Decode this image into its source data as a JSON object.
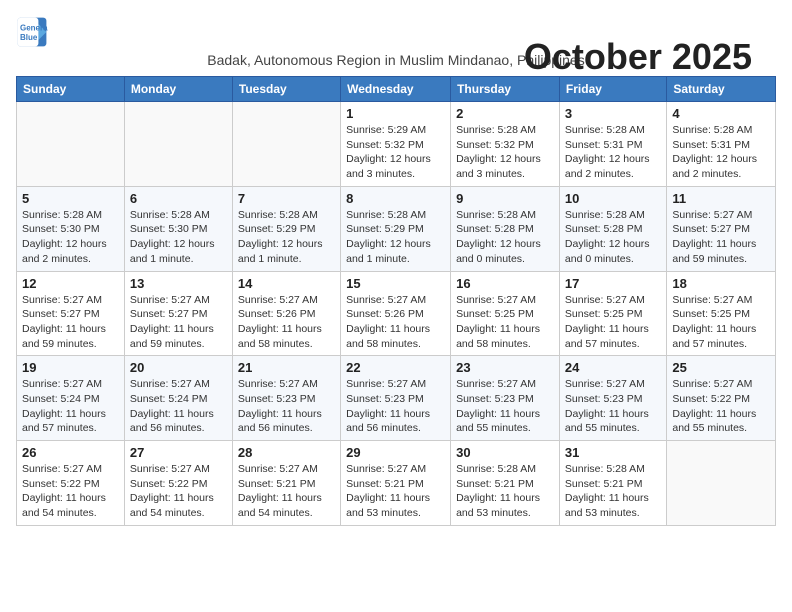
{
  "logo": {
    "line1": "General",
    "line2": "Blue"
  },
  "title": "October 2025",
  "subtitle": "Badak, Autonomous Region in Muslim Mindanao, Philippines",
  "headers": [
    "Sunday",
    "Monday",
    "Tuesday",
    "Wednesday",
    "Thursday",
    "Friday",
    "Saturday"
  ],
  "weeks": [
    [
      {
        "day": "",
        "info": ""
      },
      {
        "day": "",
        "info": ""
      },
      {
        "day": "",
        "info": ""
      },
      {
        "day": "1",
        "info": "Sunrise: 5:29 AM\nSunset: 5:32 PM\nDaylight: 12 hours\nand 3 minutes."
      },
      {
        "day": "2",
        "info": "Sunrise: 5:28 AM\nSunset: 5:32 PM\nDaylight: 12 hours\nand 3 minutes."
      },
      {
        "day": "3",
        "info": "Sunrise: 5:28 AM\nSunset: 5:31 PM\nDaylight: 12 hours\nand 2 minutes."
      },
      {
        "day": "4",
        "info": "Sunrise: 5:28 AM\nSunset: 5:31 PM\nDaylight: 12 hours\nand 2 minutes."
      }
    ],
    [
      {
        "day": "5",
        "info": "Sunrise: 5:28 AM\nSunset: 5:30 PM\nDaylight: 12 hours\nand 2 minutes."
      },
      {
        "day": "6",
        "info": "Sunrise: 5:28 AM\nSunset: 5:30 PM\nDaylight: 12 hours\nand 1 minute."
      },
      {
        "day": "7",
        "info": "Sunrise: 5:28 AM\nSunset: 5:29 PM\nDaylight: 12 hours\nand 1 minute."
      },
      {
        "day": "8",
        "info": "Sunrise: 5:28 AM\nSunset: 5:29 PM\nDaylight: 12 hours\nand 1 minute."
      },
      {
        "day": "9",
        "info": "Sunrise: 5:28 AM\nSunset: 5:28 PM\nDaylight: 12 hours\nand 0 minutes."
      },
      {
        "day": "10",
        "info": "Sunrise: 5:28 AM\nSunset: 5:28 PM\nDaylight: 12 hours\nand 0 minutes."
      },
      {
        "day": "11",
        "info": "Sunrise: 5:27 AM\nSunset: 5:27 PM\nDaylight: 11 hours\nand 59 minutes."
      }
    ],
    [
      {
        "day": "12",
        "info": "Sunrise: 5:27 AM\nSunset: 5:27 PM\nDaylight: 11 hours\nand 59 minutes."
      },
      {
        "day": "13",
        "info": "Sunrise: 5:27 AM\nSunset: 5:27 PM\nDaylight: 11 hours\nand 59 minutes."
      },
      {
        "day": "14",
        "info": "Sunrise: 5:27 AM\nSunset: 5:26 PM\nDaylight: 11 hours\nand 58 minutes."
      },
      {
        "day": "15",
        "info": "Sunrise: 5:27 AM\nSunset: 5:26 PM\nDaylight: 11 hours\nand 58 minutes."
      },
      {
        "day": "16",
        "info": "Sunrise: 5:27 AM\nSunset: 5:25 PM\nDaylight: 11 hours\nand 58 minutes."
      },
      {
        "day": "17",
        "info": "Sunrise: 5:27 AM\nSunset: 5:25 PM\nDaylight: 11 hours\nand 57 minutes."
      },
      {
        "day": "18",
        "info": "Sunrise: 5:27 AM\nSunset: 5:25 PM\nDaylight: 11 hours\nand 57 minutes."
      }
    ],
    [
      {
        "day": "19",
        "info": "Sunrise: 5:27 AM\nSunset: 5:24 PM\nDaylight: 11 hours\nand 57 minutes."
      },
      {
        "day": "20",
        "info": "Sunrise: 5:27 AM\nSunset: 5:24 PM\nDaylight: 11 hours\nand 56 minutes."
      },
      {
        "day": "21",
        "info": "Sunrise: 5:27 AM\nSunset: 5:23 PM\nDaylight: 11 hours\nand 56 minutes."
      },
      {
        "day": "22",
        "info": "Sunrise: 5:27 AM\nSunset: 5:23 PM\nDaylight: 11 hours\nand 56 minutes."
      },
      {
        "day": "23",
        "info": "Sunrise: 5:27 AM\nSunset: 5:23 PM\nDaylight: 11 hours\nand 55 minutes."
      },
      {
        "day": "24",
        "info": "Sunrise: 5:27 AM\nSunset: 5:23 PM\nDaylight: 11 hours\nand 55 minutes."
      },
      {
        "day": "25",
        "info": "Sunrise: 5:27 AM\nSunset: 5:22 PM\nDaylight: 11 hours\nand 55 minutes."
      }
    ],
    [
      {
        "day": "26",
        "info": "Sunrise: 5:27 AM\nSunset: 5:22 PM\nDaylight: 11 hours\nand 54 minutes."
      },
      {
        "day": "27",
        "info": "Sunrise: 5:27 AM\nSunset: 5:22 PM\nDaylight: 11 hours\nand 54 minutes."
      },
      {
        "day": "28",
        "info": "Sunrise: 5:27 AM\nSunset: 5:21 PM\nDaylight: 11 hours\nand 54 minutes."
      },
      {
        "day": "29",
        "info": "Sunrise: 5:27 AM\nSunset: 5:21 PM\nDaylight: 11 hours\nand 53 minutes."
      },
      {
        "day": "30",
        "info": "Sunrise: 5:28 AM\nSunset: 5:21 PM\nDaylight: 11 hours\nand 53 minutes."
      },
      {
        "day": "31",
        "info": "Sunrise: 5:28 AM\nSunset: 5:21 PM\nDaylight: 11 hours\nand 53 minutes."
      },
      {
        "day": "",
        "info": ""
      }
    ]
  ]
}
